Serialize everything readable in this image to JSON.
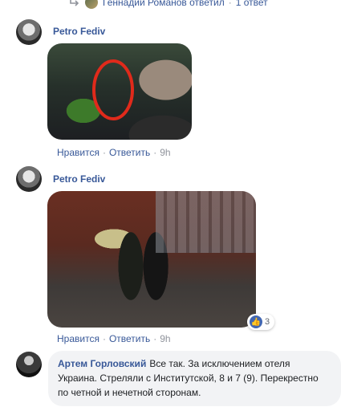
{
  "reply_thread": {
    "author": "Геннадий Романов ответил",
    "count": "1 ответ"
  },
  "comment1": {
    "author": "Petro Fediv",
    "actions": {
      "like": "Нравится",
      "reply": "Ответить",
      "time": "9h"
    }
  },
  "comment2": {
    "author": "Petro Fediv",
    "actions": {
      "like": "Нравится",
      "reply": "Ответить",
      "time": "9h"
    },
    "reactions": {
      "count": "3"
    }
  },
  "comment3": {
    "author": "Артем Горловский",
    "text": "Все так. За исключением отеля Украина. Стреляли с Институтской, 8 и 7 (9). Перекрестно по четной и нечетной сторонам."
  },
  "colors": {
    "link": "#385898",
    "muted": "#90949c",
    "bubble": "#f2f3f5",
    "annotation_circle": "#e02a1b"
  }
}
